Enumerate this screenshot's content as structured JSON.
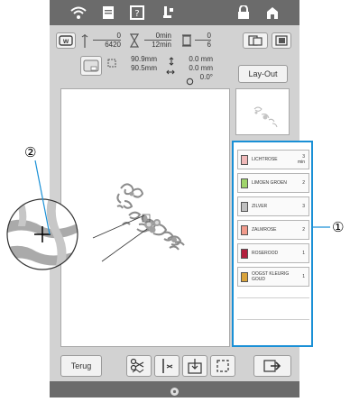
{
  "status": {
    "needle_count_top": "0",
    "needle_count_bottom": "6420",
    "time_top": "0min",
    "time_bottom": "12min",
    "color_count_top": "0",
    "color_count_bottom": "6"
  },
  "size": {
    "height": "90.9mm",
    "width": "90.5mm",
    "offset_v": "0.0 mm",
    "offset_h": "0.0 mm",
    "rotation": "0.0°"
  },
  "layout_button": "Lay-Out",
  "threads": [
    {
      "name": "LICHTROSE",
      "count": "3",
      "unit": "min",
      "color": "#f0b9b9"
    },
    {
      "name": "LIMOEN GROEN",
      "count": "2",
      "color": "#9fd46b"
    },
    {
      "name": "ZILVER",
      "count": "3",
      "color": "#c0c0c0"
    },
    {
      "name": "ZALMROSE",
      "count": "2",
      "color": "#f19b8c"
    },
    {
      "name": "ROSEROOD",
      "count": "1",
      "color": "#b3203e"
    },
    {
      "name": "OOGST KLEURIG GOUD",
      "count": "1",
      "color": "#d9a33b"
    }
  ],
  "bottom": {
    "back_label": "Terug"
  },
  "callouts": {
    "one": "①",
    "two": "②"
  },
  "colors": {
    "accent": "#1a90d6",
    "frame": "#6b6b6b",
    "panel": "#d2d2d2"
  }
}
